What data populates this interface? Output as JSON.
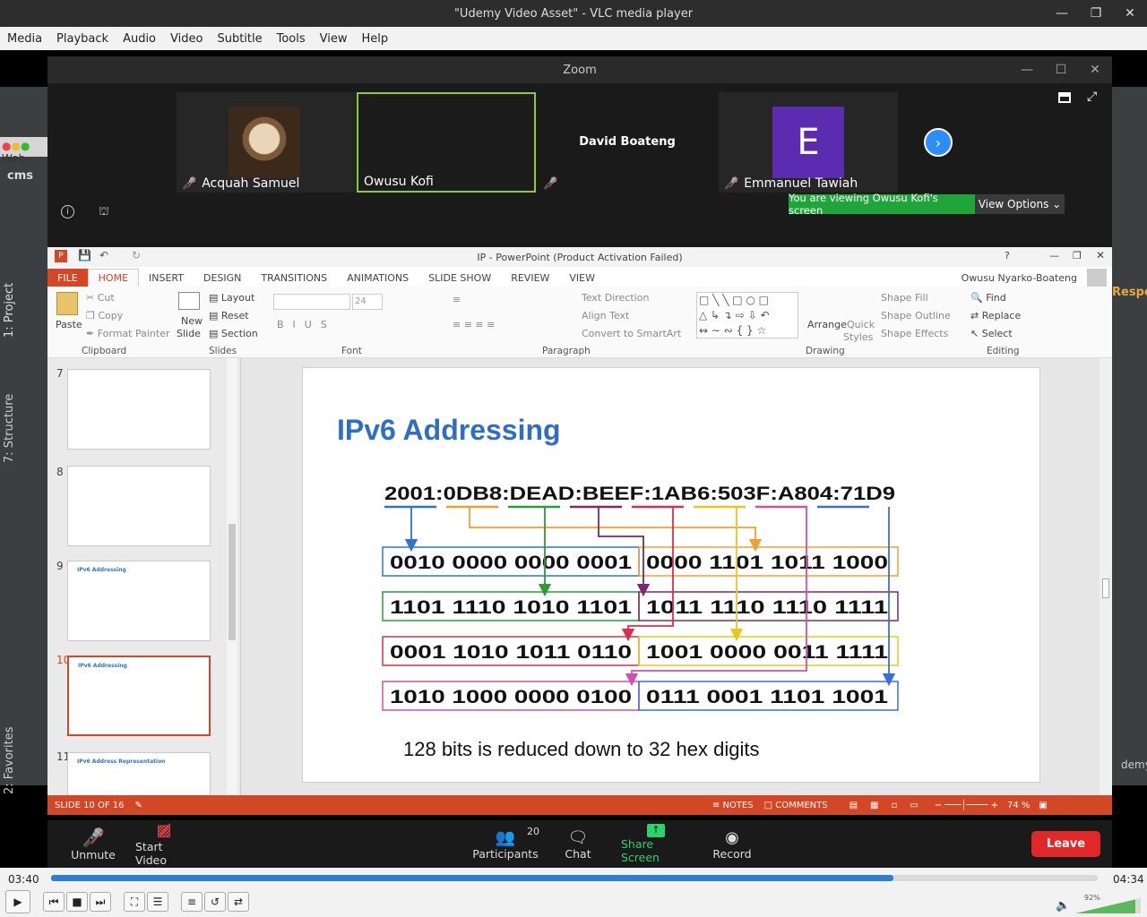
{
  "vlc": {
    "title": "\"Udemy Video Asset\" - VLC media player",
    "menu": [
      "Media",
      "Playback",
      "Audio",
      "Video",
      "Subtitle",
      "Tools",
      "View",
      "Help"
    ],
    "time_elapsed": "03:40",
    "time_total": "04:34",
    "progress": 0.805,
    "volume": "92%"
  },
  "ide": {
    "tab_project": "1: Project",
    "tab_structure": "7: Structure",
    "tab_favorites": "2: Favorites",
    "frag_cms": "cms",
    "frag_resp": "Respo",
    "frag_demy": "demy",
    "frag_web": "Web"
  },
  "zoom": {
    "title": "Zoom",
    "participants": [
      {
        "name": "Acquah Samuel",
        "muted": true
      },
      {
        "name": "Owusu Kofi",
        "muted": false
      },
      {
        "name": "David Boateng",
        "muted": true
      },
      {
        "name": "Emmanuel Tawiah",
        "muted": true,
        "initial": "E"
      }
    ],
    "viewing_banner": "You are viewing Owusu Kofi's screen",
    "view_options": "View Options",
    "toolbar": {
      "unmute": "Unmute",
      "start_video": "Start Video",
      "participants": "Participants",
      "participants_count": "20",
      "chat": "Chat",
      "share_screen": "Share Screen",
      "record": "Record",
      "leave": "Leave"
    }
  },
  "ppt": {
    "title": "IP - PowerPoint (Product Activation Failed)",
    "user": "Owusu Nyarko-Boateng",
    "tabs": [
      "FILE",
      "HOME",
      "INSERT",
      "DESIGN",
      "TRANSITIONS",
      "ANIMATIONS",
      "SLIDE SHOW",
      "REVIEW",
      "VIEW"
    ],
    "active_tab": "HOME",
    "ribbon": {
      "paste": "Paste",
      "cut": "Cut",
      "copy": "Copy",
      "format_painter": "Format Painter",
      "clipboard": "Clipboard",
      "new_slide": "New",
      "new_slide2": "Slide",
      "layout": "Layout",
      "reset": "Reset",
      "section": "Section",
      "slides": "Slides",
      "font_size": "24",
      "font": "Font",
      "paragraph": "Paragraph",
      "text_direction": "Text Direction",
      "align_text": "Align Text",
      "convert_smartart": "Convert to SmartArt",
      "arrange": "Arrange",
      "quick_styles1": "Quick",
      "quick_styles2": "Styles",
      "shape_fill": "Shape Fill",
      "shape_outline": "Shape Outline",
      "shape_effects": "Shape Effects",
      "drawing": "Drawing",
      "find": "Find",
      "replace": "Replace",
      "select": "Select",
      "editing": "Editing"
    },
    "thumbnails": [
      "7",
      "8",
      "9",
      "10",
      "11"
    ],
    "thumb_titles": {
      "t9": "IPv6 Addressing",
      "t10": "IPv6 Addressing",
      "t11": "IPv6 Address Representation"
    },
    "status": {
      "slide": "SLIDE 10 OF 16",
      "notes": "NOTES",
      "comments": "COMMENTS",
      "zoom": "74 %"
    },
    "slide": {
      "title": "IPv6 Addressing",
      "address": "2001:0DB8:DEAD:BEEF:1AB6:503F:A804:71D9",
      "rows": [
        [
          "0010 0000 0000 0001",
          "0000 1101 1011 1000"
        ],
        [
          "1101 1110 1010 1101",
          "1011 1110 1110 1111"
        ],
        [
          "0001 1010 1011 0110",
          "1001 0000 0011 1111"
        ],
        [
          "1010 1000 0000 0100",
          "0111 0001 1101 1001"
        ]
      ],
      "footer": "128 bits is reduced down to 32 hex digits",
      "colors": [
        "#2e74c9",
        "#f0a030",
        "#2e9a3a",
        "#7a2a6a",
        "#d8304a",
        "#e8c820",
        "#d050b0",
        "#3a6ee0"
      ]
    }
  }
}
